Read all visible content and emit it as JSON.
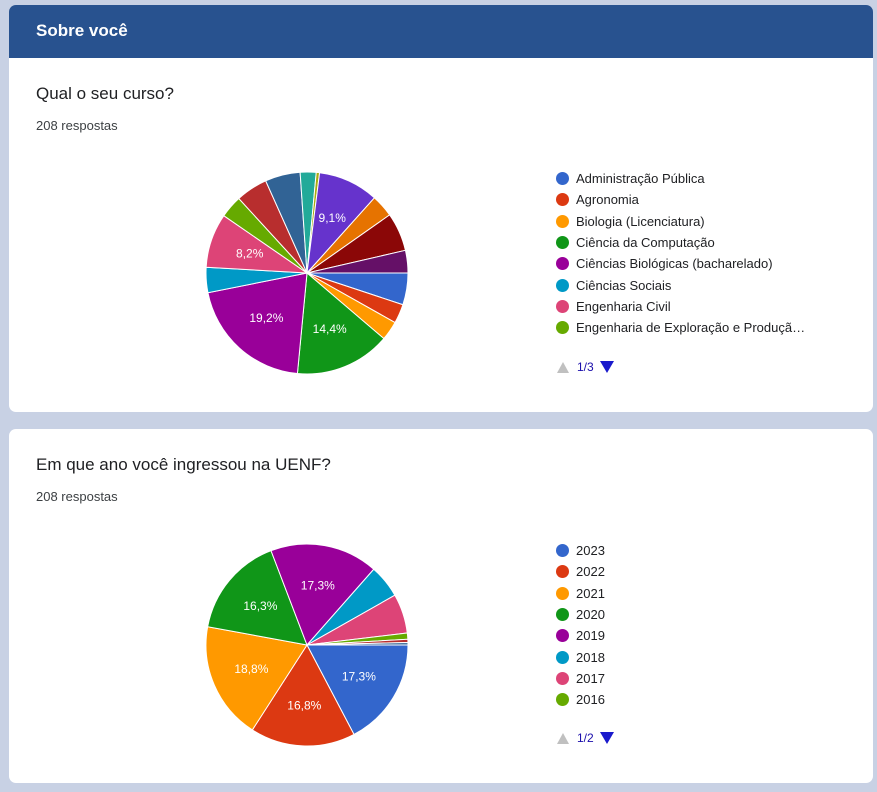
{
  "section": {
    "title": "Sobre você"
  },
  "questions": [
    {
      "title": "Qual o seu curso?",
      "count": "208 respostas",
      "pager": "1/3",
      "legend": [
        {
          "label": "Administração Pública",
          "color": "#3366cc"
        },
        {
          "label": "Agronomia",
          "color": "#dc3912"
        },
        {
          "label": "Biologia (Licenciatura)",
          "color": "#ff9900"
        },
        {
          "label": "Ciência da Computação",
          "color": "#109618"
        },
        {
          "label": "Ciências Biológicas (bacharelado)",
          "color": "#990099"
        },
        {
          "label": "Ciências Sociais",
          "color": "#0099c6"
        },
        {
          "label": "Engenharia Civil",
          "color": "#dd4477"
        },
        {
          "label": "Engenharia de Exploração e Produçã…",
          "color": "#66aa00"
        }
      ],
      "chart_data": {
        "type": "pie",
        "slices": [
          {
            "value": 4.8,
            "color": "#3366cc"
          },
          {
            "value": 2.9,
            "color": "#dc3912"
          },
          {
            "value": 2.9,
            "color": "#ff9900"
          },
          {
            "value": 14.4,
            "label": "14,4%",
            "color": "#109618"
          },
          {
            "value": 19.2,
            "label": "19,2%",
            "color": "#990099"
          },
          {
            "value": 3.8,
            "color": "#0099c6"
          },
          {
            "value": 8.2,
            "label": "8,2%",
            "color": "#dd4477"
          },
          {
            "value": 3.4,
            "color": "#66aa00"
          },
          {
            "value": 4.8,
            "color": "#b82e2e"
          },
          {
            "value": 5.3,
            "color": "#316395"
          },
          {
            "value": 2.4,
            "color": "#22aa99"
          },
          {
            "value": 0.5,
            "color": "#aaaa11"
          },
          {
            "value": 9.1,
            "label": "9,1%",
            "color": "#6633cc"
          },
          {
            "value": 3.4,
            "color": "#e67300"
          },
          {
            "value": 5.8,
            "color": "#8b0707"
          },
          {
            "value": 3.4,
            "color": "#651067"
          }
        ]
      }
    },
    {
      "title": "Em que ano você ingressou na UENF?",
      "count": "208 respostas",
      "pager": "1/2",
      "legend": [
        {
          "label": "2023",
          "color": "#3366cc"
        },
        {
          "label": "2022",
          "color": "#dc3912"
        },
        {
          "label": "2021",
          "color": "#ff9900"
        },
        {
          "label": "2020",
          "color": "#109618"
        },
        {
          "label": "2019",
          "color": "#990099"
        },
        {
          "label": "2018",
          "color": "#0099c6"
        },
        {
          "label": "2017",
          "color": "#dd4477"
        },
        {
          "label": "2016",
          "color": "#66aa00"
        }
      ],
      "chart_data": {
        "type": "pie",
        "slices": [
          {
            "value": 17.3,
            "label": "17,3%",
            "color": "#3366cc"
          },
          {
            "value": 16.8,
            "label": "16,8%",
            "color": "#dc3912"
          },
          {
            "value": 18.8,
            "label": "18,8%",
            "color": "#ff9900"
          },
          {
            "value": 16.3,
            "label": "16,3%",
            "color": "#109618"
          },
          {
            "value": 17.3,
            "label": "17,3%",
            "color": "#990099"
          },
          {
            "value": 5.3,
            "color": "#0099c6"
          },
          {
            "value": 6.3,
            "color": "#dd4477"
          },
          {
            "value": 1.0,
            "color": "#66aa00"
          },
          {
            "value": 0.5,
            "color": "#b82e2e"
          },
          {
            "value": 0.4,
            "color": "#316395"
          }
        ]
      }
    }
  ]
}
